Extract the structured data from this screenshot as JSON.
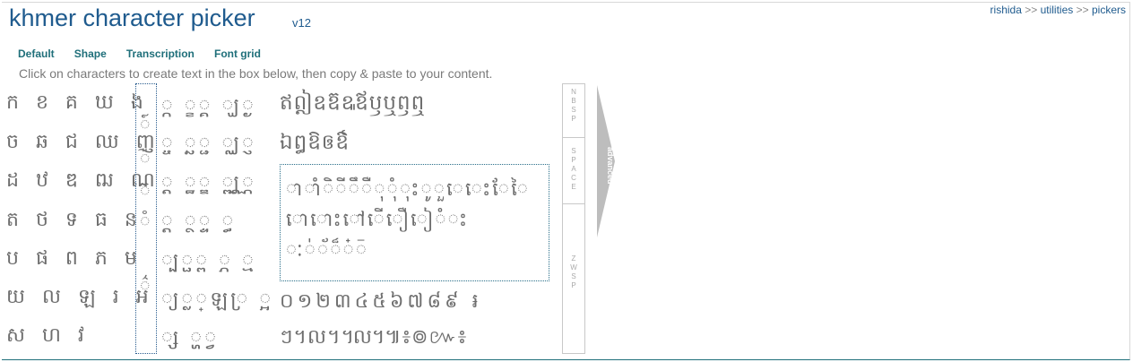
{
  "header": {
    "title": "khmer character picker",
    "version": "v12",
    "breadcrumb": [
      "rishida",
      ">>",
      "utilities",
      ">>",
      "pickers"
    ]
  },
  "tabs": [
    "Default",
    "Shape",
    "Transcription",
    "Font grid"
  ],
  "instructions": "Click on characters to create text in the box below, then copy & paste to your content.",
  "consonants": [
    "ក ខ គ ឃ ង",
    "ច ឆ ជ ឈ ញ",
    "ដ ឋ ឌ ឍ ណ",
    "ត ថ ទ ធ ន",
    "ប ផ ព ភ ម",
    "យ ល ឡ រ   អ",
    "ស ហ វ"
  ],
  "signs": [
    "◌៍",
    "◌៉",
    "◌៊",
    "◌៓",
    "◌៌"
  ],
  "subscripts": [
    "◌្ក ◌្ខ◌្គ ◌្ឃ◌្ង",
    "◌្ច ◌្ឆ◌្ជ ◌្ឈ◌្ញ",
    "◌្ដ ◌្ឋ◌្ឌ ◌្ឍ◌្ណ",
    "◌្ត ◌្ថ◌្ទ ◌្ធ",
    "◌្ប◌្ផ◌្ព ◌្ភ ◌្ម",
    "◌្យ◌្ល◌្ឡ◌្រ ◌្អ",
    "◌្ស ◌្ហ◌្វ"
  ],
  "independent_vowels": [
    "ឥឦឧឨឩឪឫឬឭឮ",
    "ឯឰឱឲឳ"
  ],
  "dependent_vowels": [
    "◌ា◌ាំ◌ិ◌ី◌ឹ◌ឺ◌ុ◌ុំ◌ុះ◌ូ◌ួ◌េ◌េះ◌ែ◌ៃ",
    "◌ោ◌ោះ◌ៅ◌ើ◌ឿ◌ៀ◌ំ◌ះ",
    "◌ៈ◌់◌័◌៏◌៎◌៑"
  ],
  "numerals": "០១២៣៤៥៦៧៨៩  ៛",
  "symbols": "ៗ។ល។៘៕៖៙៚៖",
  "space_buttons": {
    "nbsp": "NBSP",
    "space": "SPACE",
    "zwsp": "ZWSP"
  },
  "advanced_label": "advanced",
  "colors": {
    "accent": "#1f5b8e",
    "tab": "#1f6f7a",
    "glyph": "#6e6e6e",
    "instructions": "#7a7a7a"
  }
}
